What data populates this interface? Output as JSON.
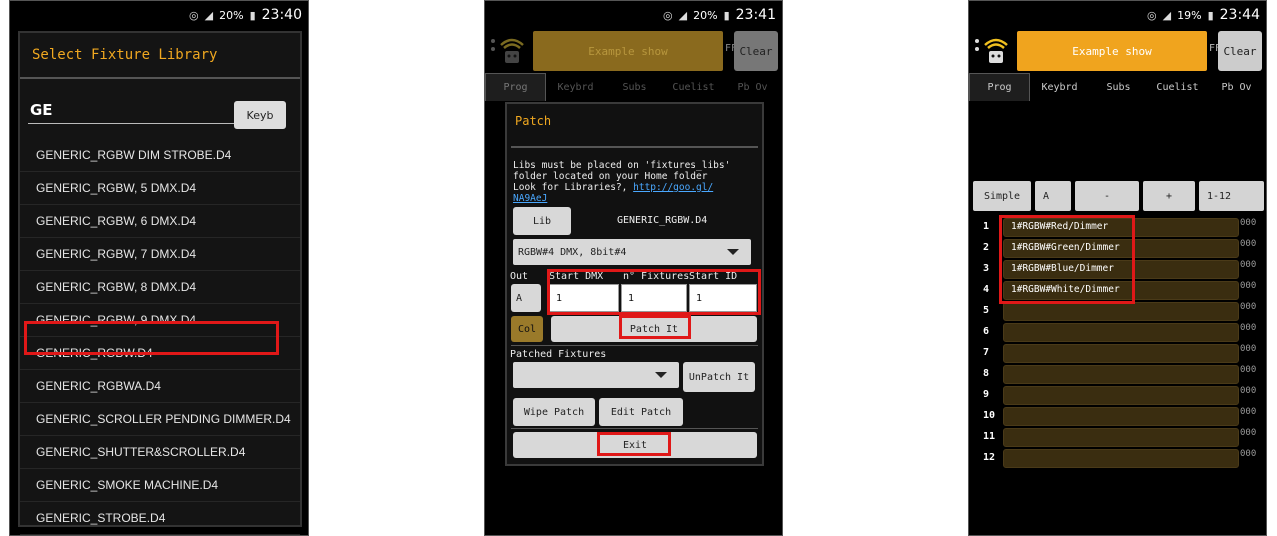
{
  "status": {
    "s1": {
      "battery": "20%",
      "time": "23:40"
    },
    "s2": {
      "battery": "20%",
      "time": "23:41"
    },
    "s3": {
      "battery": "19%",
      "time": "23:44"
    }
  },
  "fixture_library": {
    "title": "Select Fixture Library",
    "search_value": "GE",
    "keyboard_button": "Keyb",
    "items": [
      "GENERIC_RGBW DIM STROBE.D4",
      "GENERIC_RGBW, 5 DMX.D4",
      "GENERIC_RGBW, 6 DMX.D4",
      "GENERIC_RGBW, 7 DMX.D4",
      "GENERIC_RGBW, 8 DMX.D4",
      "GENERIC_RGBW, 9 DMX.D4",
      "GENERIC_RGBW.D4",
      "GENERIC_RGBWA.D4",
      "GENERIC_SCROLLER PENDING DIMMER.D4",
      "GENERIC_SHUTTER&SCROLLER.D4",
      "GENERIC_SMOKE MACHINE.D4",
      "GENERIC_STROBE.D4"
    ]
  },
  "app": {
    "show_name": "Example show",
    "ff_label": "FF",
    "clear_button": "Clear",
    "tabs": [
      "Prog",
      "Keybrd",
      "Subs",
      "Cuelist",
      "Pb Ov"
    ]
  },
  "patch": {
    "title": "Patch",
    "info_line1": "Libs must be placed on 'fixtures_libs'",
    "info_line2": "folder located on your Home folder",
    "info_line3": "Look for Libraries?,",
    "info_link1": "http://goo.gl/",
    "info_link2": "NA9AeJ",
    "lib_button": "Lib",
    "lib_name": "GENERIC_RGBW.D4",
    "mode_select": "RGBW#4 DMX, 8bit#4",
    "out_label": "Out",
    "start_dmx_label": "Start DMX",
    "num_fixtures_label": "n° Fixtures",
    "start_id_label": "Start ID",
    "out_value": "A",
    "start_dmx_value": "1",
    "num_fixtures_value": "1",
    "start_id_value": "1",
    "col_button": "Col",
    "patch_it_button": "Patch It",
    "patched_fixtures_label": "Patched Fixtures",
    "unpatch_button": "UnPatch It",
    "wipe_button": "Wipe Patch",
    "edit_button": "Edit Patch",
    "exit_button": "Exit"
  },
  "programmer": {
    "simple_button": "Simple",
    "a_button": "A",
    "minus_button": "-",
    "plus_button": "+",
    "range_button": "1-12",
    "channels": [
      {
        "num": "1",
        "label": "1#RGBW#Red/Dimmer",
        "val": "000"
      },
      {
        "num": "2",
        "label": "1#RGBW#Green/Dimmer",
        "val": "000"
      },
      {
        "num": "3",
        "label": "1#RGBW#Blue/Dimmer",
        "val": "000"
      },
      {
        "num": "4",
        "label": "1#RGBW#White/Dimmer",
        "val": "000"
      },
      {
        "num": "5",
        "label": "",
        "val": "000"
      },
      {
        "num": "6",
        "label": "",
        "val": "000"
      },
      {
        "num": "7",
        "label": "",
        "val": "000"
      },
      {
        "num": "8",
        "label": "",
        "val": "000"
      },
      {
        "num": "9",
        "label": "",
        "val": "000"
      },
      {
        "num": "10",
        "label": "",
        "val": "000"
      },
      {
        "num": "11",
        "label": "",
        "val": "000"
      },
      {
        "num": "12",
        "label": "",
        "val": "000"
      }
    ]
  },
  "colors": {
    "accent": "#f0a41e",
    "highlight": "#e01818",
    "channel_bar": "#3a2d10"
  }
}
